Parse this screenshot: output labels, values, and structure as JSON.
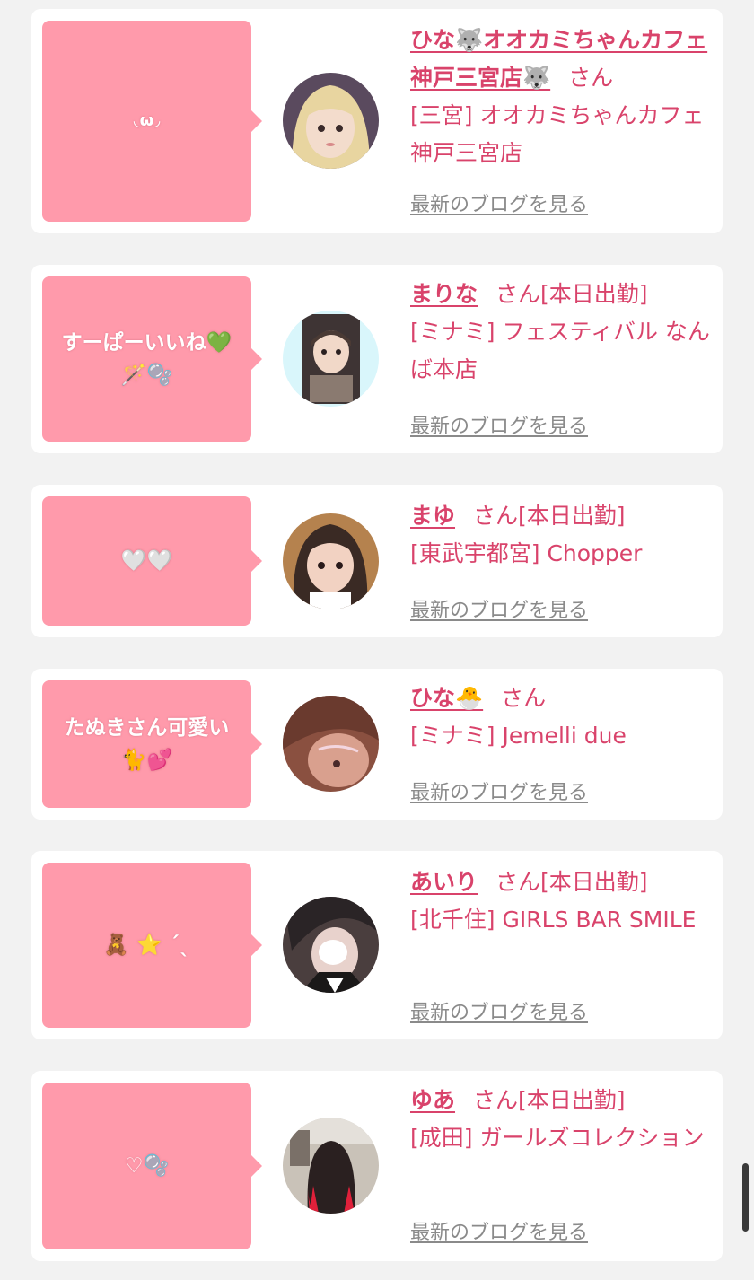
{
  "comments": [
    {
      "bubble": "◟ω◞",
      "name": "ひな🐺オオカミちゃんカフェ神戸三宮店🐺",
      "honorific": "さん",
      "status": "",
      "shop": "[三宮] オオカミちゃんカフェ神戸三宮店",
      "blog_link": "最新のブログを見る",
      "avatar_colors": [
        "#5a4a5e",
        "#f3dccc",
        "#e8d5a0"
      ]
    },
    {
      "bubble": "すーぱーいいね💚 🪄🫧",
      "name": "まりな",
      "honorific": "さん",
      "status": "[本日出勤]",
      "shop": "[ミナミ] フェスティバル なんば本店",
      "blog_link": "最新のブログを見る",
      "avatar_colors": [
        "#d9f6fb",
        "#f1d8c8",
        "#4a3a34"
      ]
    },
    {
      "bubble": "🤍🤍",
      "name": "まゆ",
      "honorific": "さん",
      "status": "[本日出勤]",
      "shop": "[東武宇都宮] Chopper",
      "blog_link": "最新のブログを見る",
      "avatar_colors": [
        "#b5824e",
        "#f2d2c2",
        "#3a2a24"
      ]
    },
    {
      "bubble": "たぬきさん可愛い 🐈💕",
      "name": "ひな🐣",
      "honorific": "さん",
      "status": "",
      "shop": "[ミナミ] Jemelli due",
      "blog_link": "最新のブログを見る",
      "avatar_colors": [
        "#6a3a2e",
        "#d9a08e",
        "#8a5040"
      ]
    },
    {
      "bubble": "🧸 ⭐ ˊˎ",
      "name": "あいり",
      "honorific": "さん",
      "status": "[本日出勤]",
      "shop": "[北千住] GIRLS BAR SMILE",
      "blog_link": "最新のブログを見る",
      "avatar_colors": [
        "#2a2426",
        "#ffffff",
        "#4a3e3e"
      ]
    },
    {
      "bubble": "♡🫧",
      "name": "ゆあ",
      "honorific": "さん",
      "status": "[本日出勤]",
      "shop": "[成田] ガールズコレクション",
      "blog_link": "最新のブログを見る",
      "avatar_colors": [
        "#c9c2b8",
        "#2a2020",
        "#e0203a"
      ]
    }
  ]
}
